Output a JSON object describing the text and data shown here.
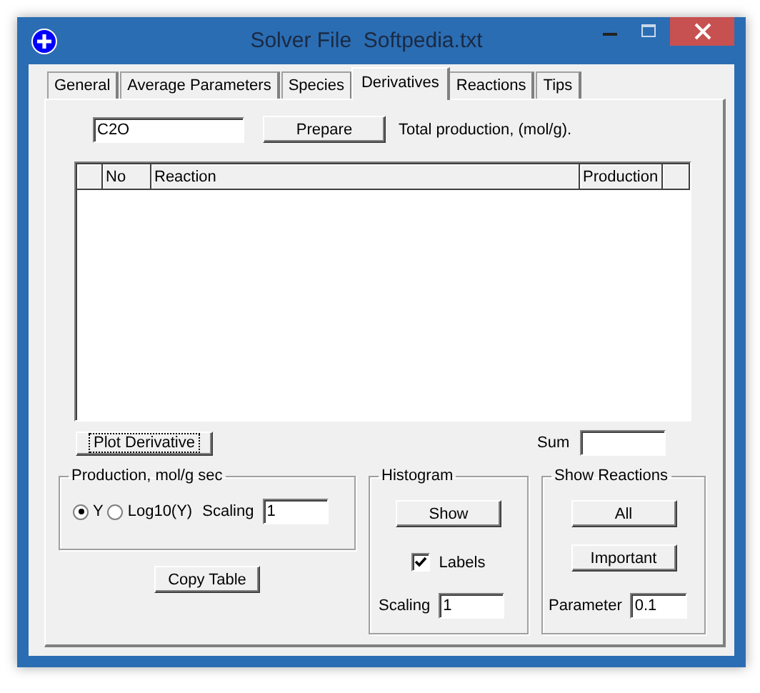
{
  "window": {
    "title": "Solver File  Softpedia.txt"
  },
  "tabs": [
    {
      "label": "General",
      "selected": false
    },
    {
      "label": "Average Parameters",
      "selected": false
    },
    {
      "label": "Species",
      "selected": false
    },
    {
      "label": "Derivatives",
      "selected": true
    },
    {
      "label": "Reactions",
      "selected": false
    },
    {
      "label": "Tips",
      "selected": false
    }
  ],
  "species_field": {
    "value": "C2O"
  },
  "prepare_button": "Prepare",
  "total_label": "Total production, (mol/g).",
  "table": {
    "columns": [
      "No",
      "Reaction",
      "Production"
    ]
  },
  "plot_button": "Plot Derivative",
  "sum_label": "Sum",
  "production": {
    "title": "Production, mol/g sec",
    "options": [
      {
        "label": "Y",
        "selected": true
      },
      {
        "label": "Log10(Y)",
        "selected": false
      }
    ],
    "scaling_label": "Scaling",
    "scaling_value": "1"
  },
  "copy_button": "Copy Table",
  "histogram": {
    "title": "Histogram",
    "show_button": "Show",
    "labels_checkbox": {
      "label": "Labels",
      "checked": true
    },
    "scaling_label": "Scaling",
    "scaling_value": "1"
  },
  "show_reactions": {
    "title": "Show Reactions",
    "buttons": [
      "All",
      "Important"
    ],
    "parameter_label": "Parameter",
    "parameter_value": "0.1"
  }
}
